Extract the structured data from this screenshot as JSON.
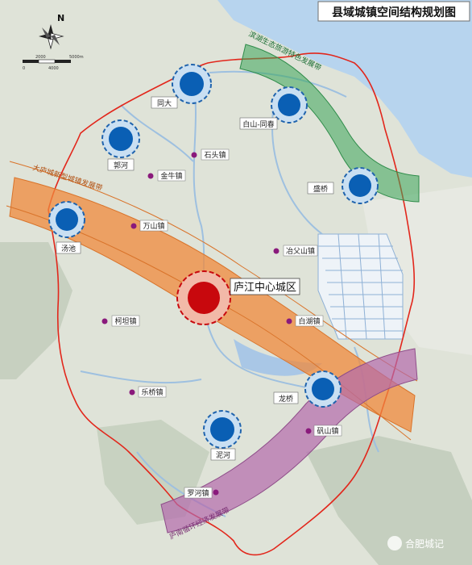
{
  "title": "县域城镇空间结构规划图",
  "center_label": "庐江中心城区",
  "corridors": {
    "green": "滨湖生态旅游特色发展带",
    "orange": "大庐城新型城镇发展带",
    "purple": "庐南循环经济发展带"
  },
  "towns_major": {
    "tongda": "同大",
    "baishan": "白山-同春",
    "guohe": "郭河",
    "shengqiao": "盛桥",
    "tangchi": "汤池",
    "longqiao": "龙桥",
    "nihe": "泥河"
  },
  "towns_minor": {
    "shitou": "石头镇",
    "jinniu": "金牛镇",
    "wanshan": "万山镇",
    "yefu": "冶父山镇",
    "keтан": "柯坦镇",
    "baihu": "白湖镇",
    "leqiao": "乐桥镇",
    "fanshan": "矾山镇",
    "luohe": "罗河镇"
  },
  "north": "N",
  "scale": {
    "a": "0",
    "b": "2000",
    "c": "4000",
    "d": "5000m"
  },
  "watermark": "合肥城记",
  "colors": {
    "green_band": "#3aa55a",
    "orange_band": "#f08a3c",
    "purple_band": "#b36aad",
    "boundary": "#e2261b",
    "node_blue": "#0a5fb4",
    "center_red": "#c8080d",
    "minor_dot": "#8a1a7c",
    "water": "#b7d4ee"
  }
}
